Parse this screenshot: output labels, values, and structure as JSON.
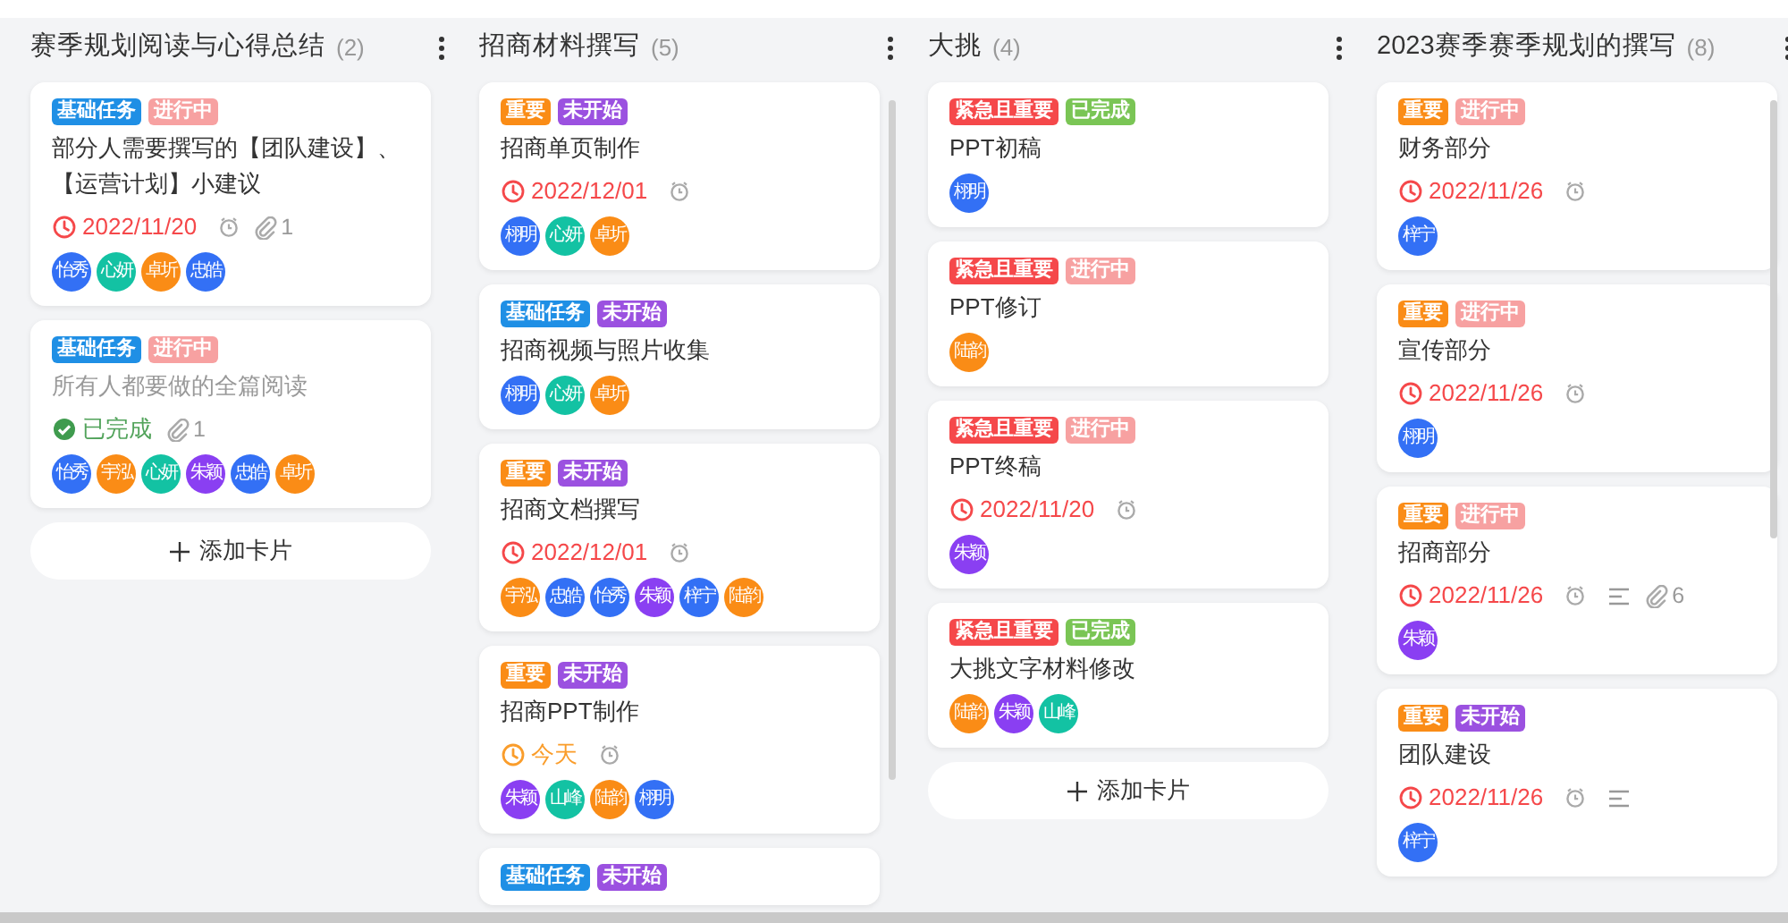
{
  "columns": [
    {
      "title": "赛季规划阅读与心得总结",
      "count": "(2)",
      "scrollable": false,
      "add_button": "添加卡片",
      "cards": [
        {
          "tags": [
            {
              "label": "基础任务",
              "color": "#1f8fe5"
            },
            {
              "label": "进行中",
              "color": "#f7a1a1"
            }
          ],
          "title": "部分人需要撰写的【团队建设】、【运营计划】小建议",
          "due": {
            "kind": "overdue",
            "text": "2022/11/20"
          },
          "reminder": true,
          "attachments": "1",
          "members": [
            {
              "name": "怡秀",
              "color": "#3370f5"
            },
            {
              "name": "心妍",
              "color": "#13c2a3"
            },
            {
              "name": "卓圻",
              "color": "#fa8c16"
            },
            {
              "name": "忠皓",
              "color": "#3370f5"
            }
          ]
        },
        {
          "tags": [
            {
              "label": "基础任务",
              "color": "#1f8fe5"
            },
            {
              "label": "进行中",
              "color": "#f7a1a1"
            }
          ],
          "title": "所有人都要做的全篇阅读",
          "due": {
            "kind": "done",
            "text": "已完成"
          },
          "attachments": "1",
          "members": [
            {
              "name": "怡秀",
              "color": "#3370f5"
            },
            {
              "name": "宇泓",
              "color": "#fa8c16"
            },
            {
              "name": "心妍",
              "color": "#13c2a3"
            },
            {
              "name": "朱颖",
              "color": "#8a3ff2"
            },
            {
              "name": "忠皓",
              "color": "#3370f5"
            },
            {
              "name": "卓圻",
              "color": "#fa8c16"
            }
          ]
        }
      ]
    },
    {
      "title": "招商材料撰写",
      "count": "(5)",
      "scrollable": true,
      "cards": [
        {
          "tags": [
            {
              "label": "重要",
              "color": "#fa8c16"
            },
            {
              "label": "未开始",
              "color": "#9b51e0"
            }
          ],
          "title": "招商单页制作",
          "due": {
            "kind": "overdue",
            "text": "2022/12/01"
          },
          "reminder": true,
          "members": [
            {
              "name": "栩明",
              "color": "#3370f5"
            },
            {
              "name": "心妍",
              "color": "#13c2a3"
            },
            {
              "name": "卓圻",
              "color": "#fa8c16"
            }
          ]
        },
        {
          "tags": [
            {
              "label": "基础任务",
              "color": "#1f8fe5"
            },
            {
              "label": "未开始",
              "color": "#9b51e0"
            }
          ],
          "title": "招商视频与照片收集",
          "members": [
            {
              "name": "栩明",
              "color": "#3370f5"
            },
            {
              "name": "心妍",
              "color": "#13c2a3"
            },
            {
              "name": "卓圻",
              "color": "#fa8c16"
            }
          ]
        },
        {
          "tags": [
            {
              "label": "重要",
              "color": "#fa8c16"
            },
            {
              "label": "未开始",
              "color": "#9b51e0"
            }
          ],
          "title": "招商文档撰写",
          "due": {
            "kind": "overdue",
            "text": "2022/12/01"
          },
          "reminder": true,
          "members": [
            {
              "name": "宇泓",
              "color": "#fa8c16"
            },
            {
              "name": "忠皓",
              "color": "#3370f5"
            },
            {
              "name": "怡秀",
              "color": "#3370f5"
            },
            {
              "name": "朱颖",
              "color": "#8a3ff2"
            },
            {
              "name": "梓宁",
              "color": "#3370f5"
            },
            {
              "name": "陆韵",
              "color": "#fa8c16"
            }
          ]
        },
        {
          "tags": [
            {
              "label": "重要",
              "color": "#fa8c16"
            },
            {
              "label": "未开始",
              "color": "#9b51e0"
            }
          ],
          "title": "招商PPT制作",
          "due": {
            "kind": "today",
            "text": "今天"
          },
          "reminder": true,
          "members": [
            {
              "name": "朱颖",
              "color": "#8a3ff2"
            },
            {
              "name": "山峰",
              "color": "#13c2a3"
            },
            {
              "name": "陆韵",
              "color": "#fa8c16"
            },
            {
              "name": "栩明",
              "color": "#3370f5"
            }
          ]
        },
        {
          "tags": [
            {
              "label": "基础任务",
              "color": "#1f8fe5"
            },
            {
              "label": "未开始",
              "color": "#9b51e0"
            }
          ]
        }
      ]
    },
    {
      "title": "大挑",
      "count": "(4)",
      "scrollable": false,
      "add_button": "添加卡片",
      "cards": [
        {
          "tags": [
            {
              "label": "紧急且重要",
              "color": "#f5484a"
            },
            {
              "label": "已完成",
              "color": "#7ac555"
            }
          ],
          "title": "PPT初稿",
          "members": [
            {
              "name": "栩明",
              "color": "#3370f5"
            }
          ]
        },
        {
          "tags": [
            {
              "label": "紧急且重要",
              "color": "#f5484a"
            },
            {
              "label": "进行中",
              "color": "#f7a1a1"
            }
          ],
          "title": "PPT修订",
          "members": [
            {
              "name": "陆韵",
              "color": "#fa8c16"
            }
          ]
        },
        {
          "tags": [
            {
              "label": "紧急且重要",
              "color": "#f5484a"
            },
            {
              "label": "进行中",
              "color": "#f7a1a1"
            }
          ],
          "title": "PPT终稿",
          "due": {
            "kind": "overdue",
            "text": "2022/11/20"
          },
          "reminder": true,
          "members": [
            {
              "name": "朱颖",
              "color": "#8a3ff2"
            }
          ]
        },
        {
          "tags": [
            {
              "label": "紧急且重要",
              "color": "#f5484a"
            },
            {
              "label": "已完成",
              "color": "#7ac555"
            }
          ],
          "title": "大挑文字材料修改",
          "members": [
            {
              "name": "陆韵",
              "color": "#fa8c16"
            },
            {
              "name": "朱颖",
              "color": "#8a3ff2"
            },
            {
              "name": "山峰",
              "color": "#13c2a3"
            }
          ]
        }
      ]
    },
    {
      "title": "2023赛季赛季规划的撰写",
      "count": "(8)",
      "scrollable": true,
      "cards": [
        {
          "tags": [
            {
              "label": "重要",
              "color": "#fa8c16"
            },
            {
              "label": "进行中",
              "color": "#f7a1a1"
            }
          ],
          "title": "财务部分",
          "due": {
            "kind": "overdue",
            "text": "2022/11/26"
          },
          "reminder": true,
          "members": [
            {
              "name": "梓宁",
              "color": "#3370f5"
            }
          ]
        },
        {
          "tags": [
            {
              "label": "重要",
              "color": "#fa8c16"
            },
            {
              "label": "进行中",
              "color": "#f7a1a1"
            }
          ],
          "title": "宣传部分",
          "due": {
            "kind": "overdue",
            "text": "2022/11/26"
          },
          "reminder": true,
          "members": [
            {
              "name": "栩明",
              "color": "#3370f5"
            }
          ]
        },
        {
          "tags": [
            {
              "label": "重要",
              "color": "#fa8c16"
            },
            {
              "label": "进行中",
              "color": "#f7a1a1"
            }
          ],
          "title": "招商部分",
          "due": {
            "kind": "overdue",
            "text": "2022/11/26"
          },
          "reminder": true,
          "description": true,
          "attachments": "6",
          "members": [
            {
              "name": "朱颖",
              "color": "#8a3ff2"
            }
          ]
        },
        {
          "tags": [
            {
              "label": "重要",
              "color": "#fa8c16"
            },
            {
              "label": "未开始",
              "color": "#9b51e0"
            }
          ],
          "title": "团队建设",
          "due": {
            "kind": "overdue",
            "text": "2022/11/26"
          },
          "reminder": true,
          "description": true,
          "members": [
            {
              "name": "梓宁",
              "color": "#3370f5"
            }
          ]
        }
      ]
    }
  ]
}
